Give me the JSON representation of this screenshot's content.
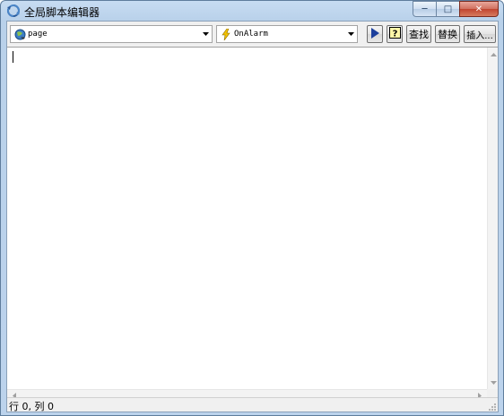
{
  "window": {
    "title": "全局脚本编辑器",
    "minimize_label": "─",
    "maximize_label": "□",
    "close_label": "✕"
  },
  "toolbar": {
    "object_combo": {
      "value": "page",
      "icon": "page-object-icon"
    },
    "event_combo": {
      "value": "OnAlarm",
      "icon": "lightning-icon"
    },
    "run_icon": "play-icon",
    "help_icon": "help-icon",
    "find_label": "查找",
    "replace_label": "替换",
    "insert_label": "插入..."
  },
  "editor": {
    "content": ""
  },
  "statusbar": {
    "position_text": "行 0, 列 0"
  }
}
